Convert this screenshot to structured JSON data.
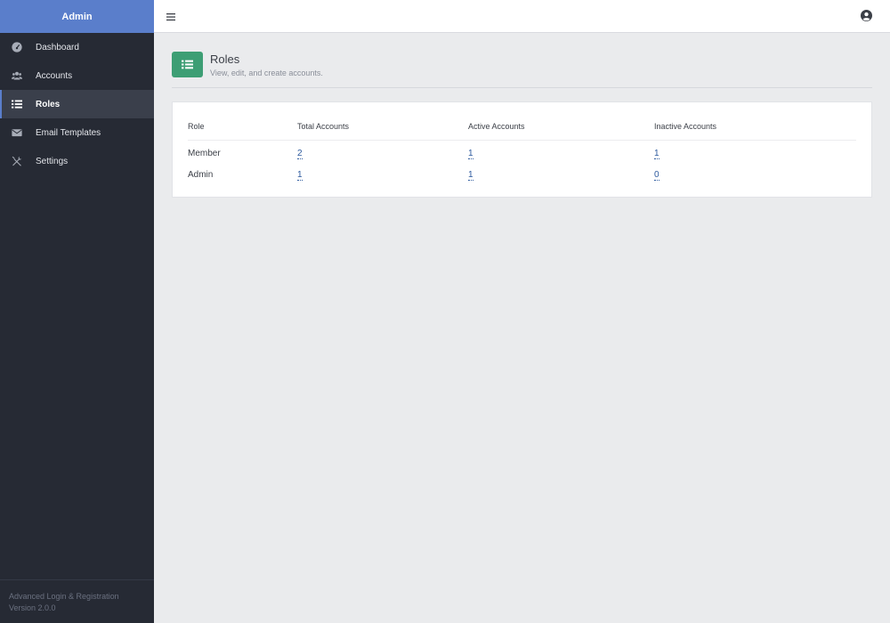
{
  "sidebar": {
    "title": "Admin",
    "items": [
      {
        "label": "Dashboard",
        "icon": "dashboard-icon"
      },
      {
        "label": "Accounts",
        "icon": "users-icon"
      },
      {
        "label": "Roles",
        "icon": "list-icon",
        "active": true
      },
      {
        "label": "Email Templates",
        "icon": "envelope-icon"
      },
      {
        "label": "Settings",
        "icon": "tools-icon"
      }
    ],
    "footer": {
      "app_name": "Advanced Login & Registration",
      "version": "Version 2.0.0"
    }
  },
  "header": {
    "menu_icon": "menu-icon",
    "profile_icon": "user-circle-icon"
  },
  "page": {
    "title": "Roles",
    "subtitle": "View, edit, and create accounts.",
    "icon": "list-icon",
    "accent": "#3d9e74"
  },
  "table": {
    "columns": [
      "Role",
      "Total Accounts",
      "Active Accounts",
      "Inactive Accounts"
    ],
    "rows": [
      {
        "role": "Member",
        "total": "2",
        "active": "1",
        "inactive": "1"
      },
      {
        "role": "Admin",
        "total": "1",
        "active": "1",
        "inactive": "0"
      }
    ]
  },
  "colors": {
    "sidebar_bg": "#262a34",
    "sidebar_header": "#5a7ecb",
    "content_bg": "#eaebed",
    "link": "#2d5a9e"
  }
}
